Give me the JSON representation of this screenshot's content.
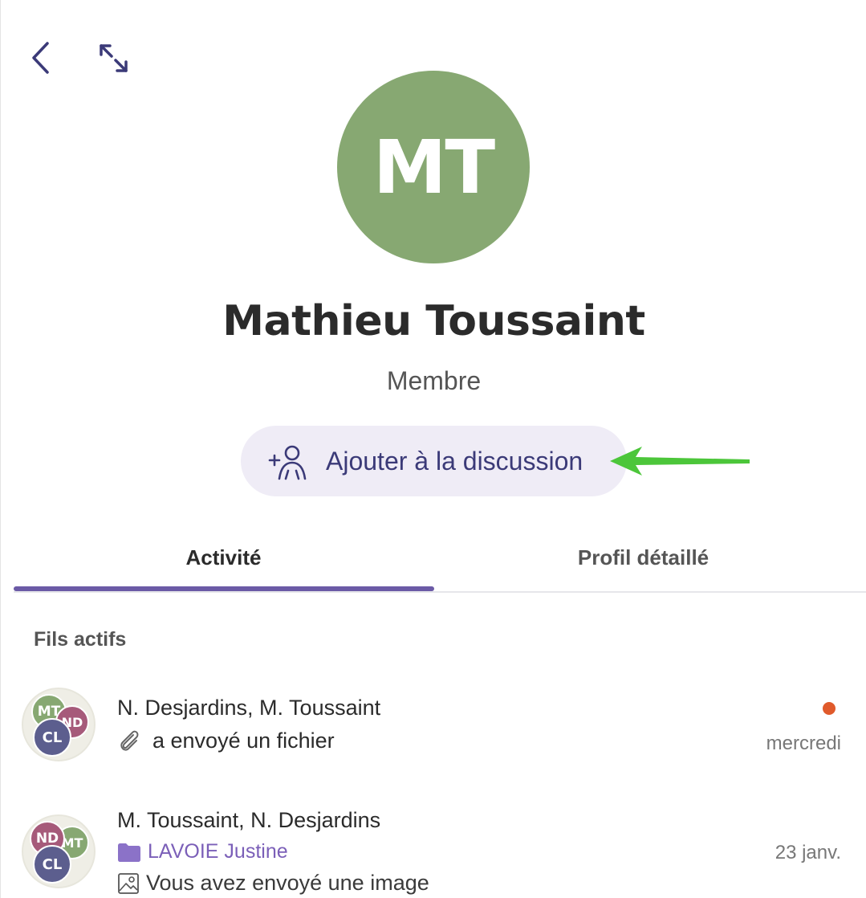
{
  "header": {
    "back_icon": "chevron-left-icon",
    "expand_icon": "expand-arrows-icon"
  },
  "profile": {
    "initials": "MT",
    "avatar_color": "#87a872",
    "name": "Mathieu Toussaint",
    "role": "Membre",
    "add_button_label": "Ajouter à la discussion",
    "add_button_icon": "add-person-icon"
  },
  "annotation": {
    "arrow_color": "#4cc63a"
  },
  "tabs": [
    {
      "label": "Activité",
      "active": true
    },
    {
      "label": "Profil détaillé",
      "active": false
    }
  ],
  "accent_color": "#6b5aa6",
  "section_title": "Fils actifs",
  "threads": [
    {
      "participants": "N. Desjardins, M. Toussaint",
      "avatars": [
        {
          "initials": "MT",
          "color": "#87a872"
        },
        {
          "initials": "ND",
          "color": "#a65a7a"
        },
        {
          "initials": "CL",
          "color": "#5c5e8e"
        }
      ],
      "preview_icon": "paperclip-icon",
      "preview": "a envoyé un fichier",
      "date": "mercredi",
      "unread": true,
      "unread_color": "#e05a2b"
    },
    {
      "participants": "M. Toussaint, N. Desjardins",
      "avatars": [
        {
          "initials": "ND",
          "color": "#a65a7a"
        },
        {
          "initials": "MT",
          "color": "#87a872"
        },
        {
          "initials": "CL",
          "color": "#5c5e8e"
        }
      ],
      "folder_icon": "folder-icon",
      "folder": "LAVOIE Justine",
      "folder_color": "#7b5fb8",
      "preview_icon": "image-icon",
      "preview": "Vous avez envoyé une image",
      "date": "23 janv.",
      "unread": false
    }
  ]
}
